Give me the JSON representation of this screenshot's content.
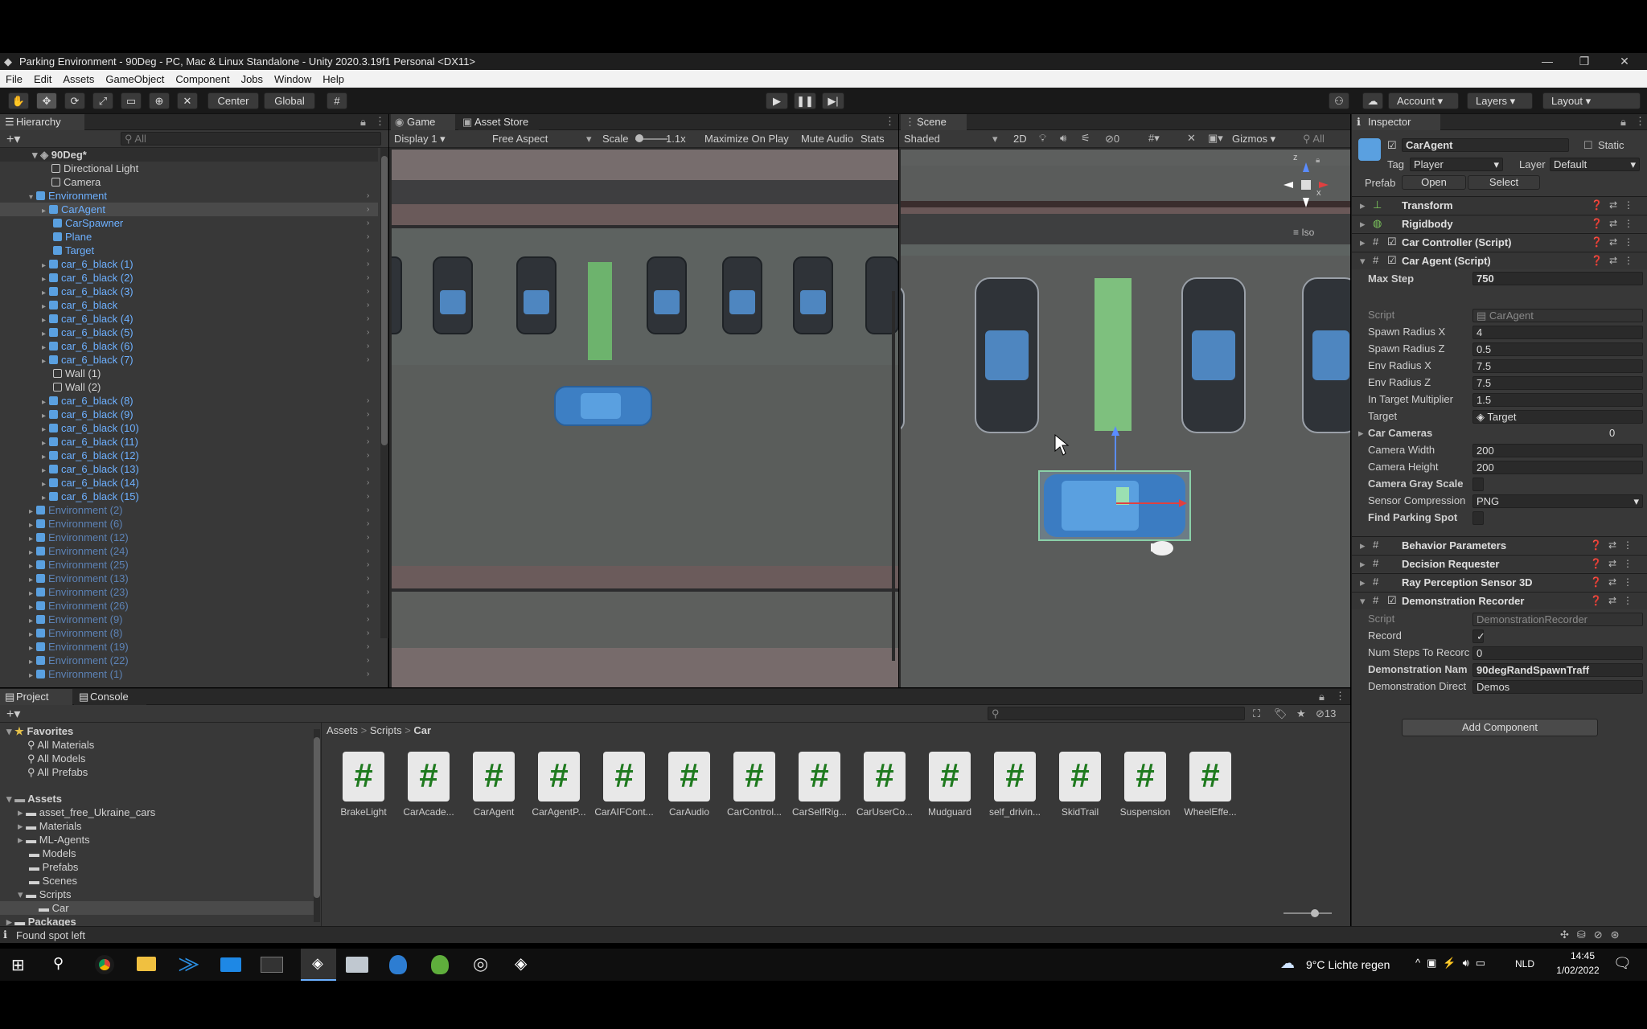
{
  "window": {
    "title": "Parking Environment - 90Deg - PC, Mac & Linux Standalone - Unity 2020.3.19f1 Personal <DX11>"
  },
  "menu": [
    "File",
    "Edit",
    "Assets",
    "GameObject",
    "Component",
    "Jobs",
    "Window",
    "Help"
  ],
  "toolbar": {
    "center": "Center",
    "global": "Global",
    "account": "Account",
    "layers": "Layers",
    "layout": "Layout"
  },
  "hierarchy": {
    "tab": "Hierarchy",
    "search_placeholder": "All",
    "scene": "90Deg*",
    "items": [
      "Directional Light",
      "Camera",
      "Environment",
      "CarAgent",
      "CarSpawner",
      "Plane",
      "Target",
      "car_6_black (1)",
      "car_6_black (2)",
      "car_6_black (3)",
      "car_6_black",
      "car_6_black (4)",
      "car_6_black (5)",
      "car_6_black (6)",
      "car_6_black (7)",
      "Wall (1)",
      "Wall (2)",
      "car_6_black (8)",
      "car_6_black (9)",
      "car_6_black (10)",
      "car_6_black (11)",
      "car_6_black (12)",
      "car_6_black (13)",
      "car_6_black (14)",
      "car_6_black (15)",
      "Environment (2)",
      "Environment (6)",
      "Environment (12)",
      "Environment (24)",
      "Environment (25)",
      "Environment (13)",
      "Environment (23)",
      "Environment (26)",
      "Environment (9)",
      "Environment (8)",
      "Environment (19)",
      "Environment (22)",
      "Environment (1)"
    ]
  },
  "game": {
    "tab": "Game",
    "tab2": "Asset Store",
    "display": "Display 1",
    "aspect": "Free Aspect",
    "scale_label": "Scale",
    "scale": "1.1x",
    "maximize": "Maximize On Play",
    "mute": "Mute Audio",
    "stats": "Stats"
  },
  "scene": {
    "tab": "Scene",
    "shading": "Shaded",
    "mode2d": "2D",
    "gizmos": "Gizmos",
    "search": "All",
    "hidden_count": "0",
    "iso": "Iso",
    "axis_x": "x",
    "axis_z": "z"
  },
  "inspector": {
    "tab": "Inspector",
    "object": "CarAgent",
    "static": "Static",
    "tag_label": "Tag",
    "tag": "Player",
    "layer_label": "Layer",
    "layer": "Default",
    "prefab_label": "Prefab",
    "open": "Open",
    "select": "Select",
    "components": [
      "Transform",
      "Rigidbody",
      "Car Controller (Script)",
      "Car Agent (Script)"
    ],
    "max_step_label": "Max Step",
    "max_step": "750",
    "fields": [
      {
        "l": "Script",
        "v": "CarAgent"
      },
      {
        "l": "Spawn Radius X",
        "v": "4"
      },
      {
        "l": "Spawn Radius Z",
        "v": "0.5"
      },
      {
        "l": "Env Radius X",
        "v": "7.5"
      },
      {
        "l": "Env Radius Z",
        "v": "7.5"
      },
      {
        "l": "In Target Multiplier",
        "v": "1.5"
      },
      {
        "l": "Target",
        "v": "Target"
      },
      {
        "l": "Car Cameras",
        "v": "0"
      },
      {
        "l": "Camera Width",
        "v": "200"
      },
      {
        "l": "Camera Height",
        "v": "200"
      },
      {
        "l": "Camera Gray Scale",
        "v": ""
      },
      {
        "l": "Sensor Compression",
        "v": "PNG"
      },
      {
        "l": "Find Parking Spot",
        "v": ""
      }
    ],
    "components2": [
      "Behavior Parameters",
      "Decision Requester",
      "Ray Perception Sensor 3D",
      "Demonstration Recorder"
    ],
    "rec_fields": [
      {
        "l": "Script",
        "v": "DemonstrationRecorder"
      },
      {
        "l": "Record",
        "v": "✓"
      },
      {
        "l": "Num Steps To Recorc",
        "v": "0"
      },
      {
        "l": "Demonstration Nam",
        "v": "90degRandSpawnTraff"
      },
      {
        "l": "Demonstration Direct",
        "v": "Demos"
      }
    ],
    "add_component": "Add Component"
  },
  "project": {
    "tab": "Project",
    "tab2": "Console",
    "favorites": "Favorites",
    "fav_items": [
      "All Materials",
      "All Models",
      "All Prefabs"
    ],
    "assets": "Assets",
    "asset_folders": [
      "asset_free_Ukraine_cars",
      "Materials",
      "ML-Agents",
      "Models",
      "Prefabs",
      "Scenes",
      "Scripts",
      "Car"
    ],
    "packages": "Packages",
    "breadcrumb": [
      "Assets",
      "Scripts",
      "Car"
    ],
    "count": "13",
    "files": [
      "BrakeLight",
      "CarAcade...",
      "CarAgent",
      "CarAgentP...",
      "CarAIFCont...",
      "CarAudio",
      "CarControl...",
      "CarSelfRig...",
      "CarUserCo...",
      "Mudguard",
      "self_drivin...",
      "SkidTrail",
      "Suspension",
      "WheelEffe..."
    ]
  },
  "status": {
    "text": "Found spot left"
  },
  "taskbar": {
    "weather": "9°C  Lichte regen",
    "lang": "NLD",
    "time": "14:45",
    "date": "1/02/2022"
  }
}
